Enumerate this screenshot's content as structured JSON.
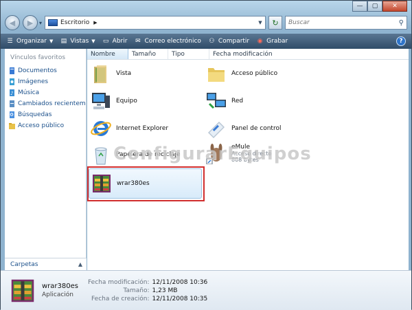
{
  "window": {
    "caption": {
      "minimize": "—",
      "maximize": "▢",
      "close": "✕"
    }
  },
  "address": {
    "back": "◀",
    "forward": "▶",
    "history": "▾",
    "location": "Escritorio",
    "separator": "▶",
    "refresh": "↻",
    "search_placeholder": "Buscar"
  },
  "toolbar": {
    "items": [
      {
        "label": "Organizar",
        "has_arrow": true
      },
      {
        "label": "Vistas",
        "has_arrow": true
      },
      {
        "label": "Abrir",
        "has_arrow": false
      },
      {
        "label": "Correo electrónico",
        "has_arrow": false
      },
      {
        "label": "Compartir",
        "has_arrow": false
      },
      {
        "label": "Grabar",
        "has_arrow": false
      }
    ],
    "help": "?"
  },
  "nav": {
    "heading": "Vínculos favoritos",
    "items": [
      {
        "label": "Documentos",
        "color": "#3a7bd5"
      },
      {
        "label": "Imágenes",
        "color": "#3aa0d5"
      },
      {
        "label": "Música",
        "color": "#3a8fd5"
      },
      {
        "label": "Cambiados recientemente",
        "color": "#5a8fc5"
      },
      {
        "label": "Búsquedas",
        "color": "#4a90e0"
      },
      {
        "label": "Acceso público",
        "color": "#e8c24a"
      }
    ],
    "folders": "Carpetas",
    "folders_chevron": "▲"
  },
  "columns": [
    "Nombre",
    "Tamaño",
    "Tipo",
    "Fecha modificación"
  ],
  "items": [
    {
      "label": "Vista",
      "icon": "folder-icon"
    },
    {
      "label": "Acceso público",
      "icon": "folder-icon"
    },
    {
      "label": "Equipo",
      "icon": "computer-icon"
    },
    {
      "label": "Red",
      "icon": "network-icon"
    },
    {
      "label": "Internet Explorer",
      "icon": "internet-explorer-icon"
    },
    {
      "label": "Panel de control",
      "icon": "control-panel-icon"
    },
    {
      "label": "Papelera de reciclaje",
      "icon": "recycle-bin-icon"
    },
    {
      "label": "eMule",
      "sub1": "Acceso directo",
      "sub2": "808 bytes",
      "icon": "emule-icon"
    },
    {
      "label": "wrar380es",
      "icon": "winrar-icon"
    }
  ],
  "watermark": "ConfigurarEquipos",
  "details": {
    "name": "wrar380es",
    "type": "Aplicación",
    "fields": [
      {
        "key": "Fecha modificación:",
        "value": "12/11/2008 10:36"
      },
      {
        "key": "Tamaño:",
        "value": "1,23 MB"
      },
      {
        "key": "Fecha de creación:",
        "value": "12/11/2008 10:35"
      }
    ]
  },
  "colors": {
    "toolbar": "#3d5a77",
    "link": "#1a4f8a",
    "highlight": "#d12d2d"
  }
}
